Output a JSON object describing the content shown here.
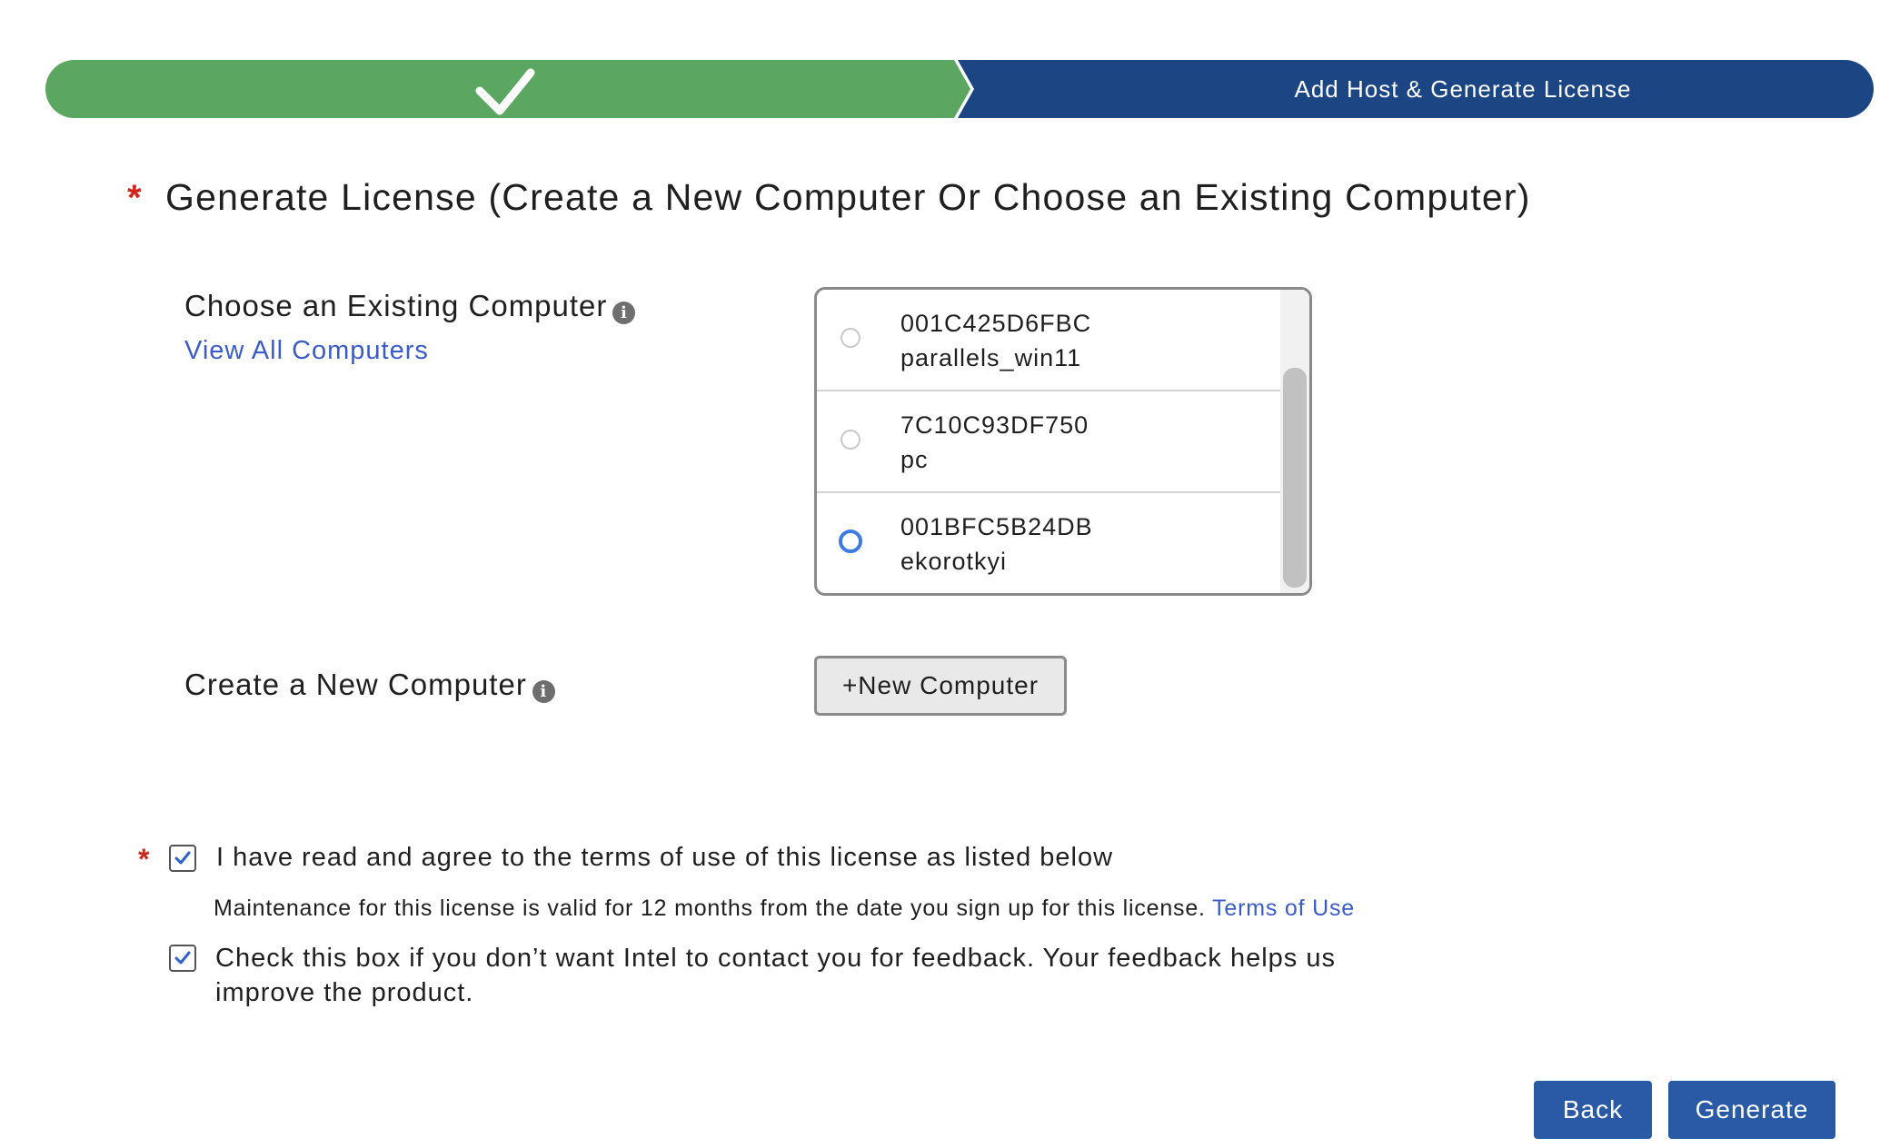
{
  "progress": {
    "step1_status": "completed",
    "step2_label": "Add Host & Generate License",
    "colors": {
      "completed": "#5ba661",
      "active": "#1c4584"
    }
  },
  "section": {
    "required_mark": "*",
    "title": "Generate License (Create a New Computer Or Choose an Existing Computer)"
  },
  "existing": {
    "label": "Choose an Existing Computer",
    "info_icon": "i",
    "view_all_link": "View All Computers",
    "computers": [
      {
        "id": "001C425D6FBC",
        "name": "parallels_win11",
        "selected": false
      },
      {
        "id": "7C10C93DF750",
        "name": "pc",
        "selected": false
      },
      {
        "id": "001BFC5B24DB",
        "name": "ekorotkyi",
        "selected": true
      }
    ]
  },
  "new_computer": {
    "label": "Create a New Computer",
    "info_icon": "i",
    "button_label": "+New Computer"
  },
  "terms": {
    "required_mark": "*",
    "agree_label": "I have read and agree to the terms of use of this license as listed below",
    "agree_checked": true,
    "maintenance_text": "Maintenance for this license is valid for 12 months from the date you sign up for this license.",
    "terms_link": "Terms of Use",
    "feedback_label": "Check this box if you don’t want Intel to contact you for feedback. Your feedback helps us improve the product.",
    "feedback_checked": true
  },
  "actions": {
    "back_label": "Back",
    "generate_label": "Generate",
    "button_color": "#2a5aa5"
  }
}
